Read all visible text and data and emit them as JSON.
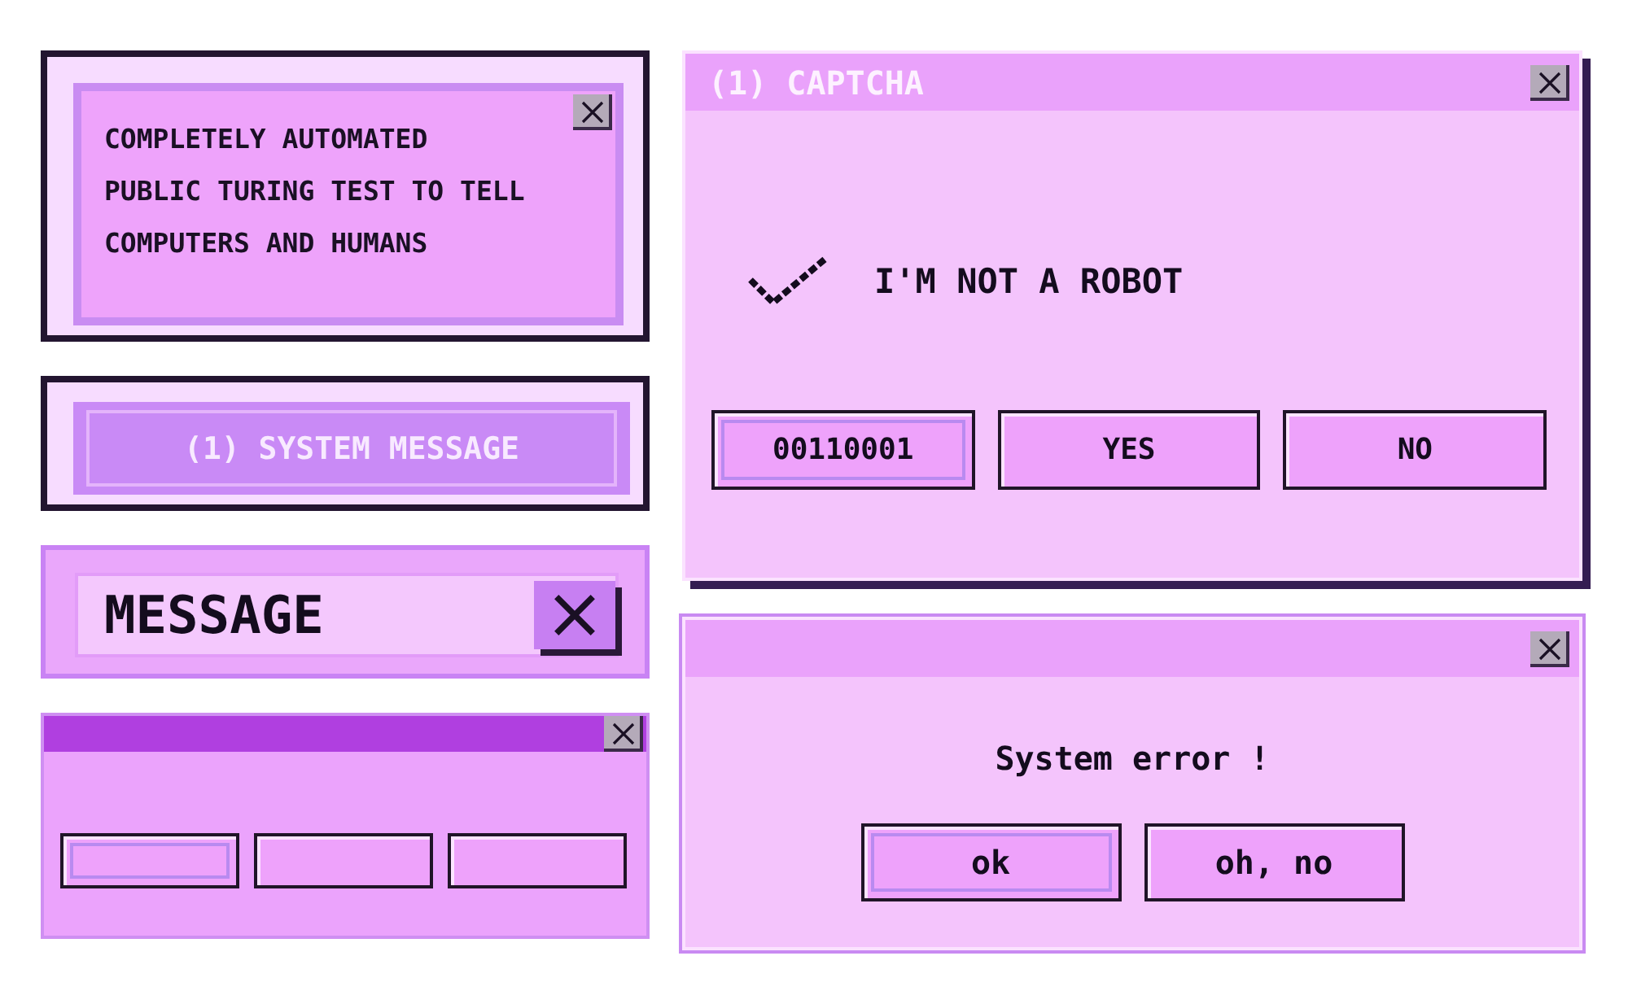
{
  "left_column": [
    {
      "kind": "notice",
      "text": "COMPLETELY AUTOMATED\nPUBLIC TURING TEST TO TELL\nCOMPUTERS AND HUMANS",
      "close_button": true
    },
    {
      "kind": "system_message",
      "text": "(1) SYSTEM MESSAGE"
    },
    {
      "kind": "message_bar",
      "text": "MESSAGE",
      "close_button": true
    },
    {
      "kind": "button_dialog",
      "close_button": true,
      "buttons": [
        {
          "focused": true
        },
        {
          "focused": false
        },
        {
          "focused": false
        }
      ]
    }
  ],
  "right_column": [
    {
      "kind": "captcha",
      "title": "(1) CAPTCHA",
      "close_button": true,
      "checked": true,
      "label": "I'M NOT A ROBOT",
      "buttons": [
        {
          "label": "00110001",
          "focused": true
        },
        {
          "label": "YES",
          "focused": false
        },
        {
          "label": "NO",
          "focused": false
        }
      ]
    },
    {
      "kind": "error",
      "close_button": true,
      "message": "System error !",
      "buttons": [
        {
          "label": "ok",
          "focused": true
        },
        {
          "label": "oh, no",
          "focused": false
        }
      ]
    }
  ]
}
